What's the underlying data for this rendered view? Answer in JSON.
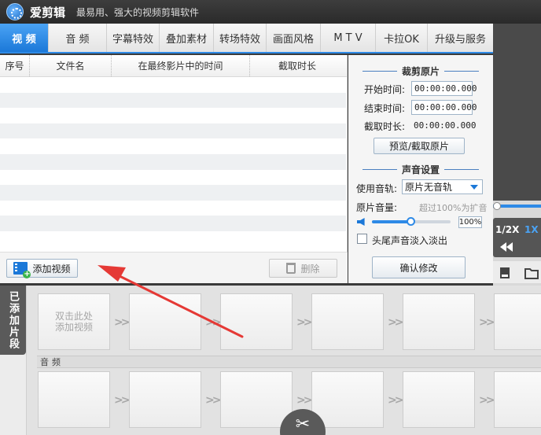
{
  "app": {
    "name": "爱剪辑",
    "slogan": "最易用、强大的视频剪辑软件"
  },
  "tabs": [
    {
      "label": "视 频",
      "active": true
    },
    {
      "label": "音 频",
      "active": false
    },
    {
      "label": "字幕特效",
      "active": false
    },
    {
      "label": "叠加素材",
      "active": false
    },
    {
      "label": "转场特效",
      "active": false
    },
    {
      "label": "画面风格",
      "active": false
    },
    {
      "label": "M T V",
      "active": false
    },
    {
      "label": "卡拉OK",
      "active": false
    },
    {
      "label": "升级与服务",
      "active": false
    }
  ],
  "file_table": {
    "columns": [
      "序号",
      "文件名",
      "在最终影片中的时间",
      "截取时长"
    ],
    "rows": []
  },
  "buttons": {
    "add_video": "添加视频",
    "delete": "删除",
    "preview_clip": "预览/截取原片",
    "confirm": "确认修改"
  },
  "clip_settings": {
    "title": "裁剪原片",
    "start_label": "开始时间:",
    "start_value": "00:00:00.000",
    "end_label": "结束时间:",
    "end_value": "00:00:00.000",
    "duration_label": "截取时长:",
    "duration_value": "00:00:00.000"
  },
  "sound_settings": {
    "title": "声音设置",
    "track_label": "使用音轨:",
    "track_value": "原片无音轨",
    "volume_label": "原片音量:",
    "volume_hint": "超过100%为扩音",
    "volume_percent": "100%",
    "volume_level": 0.5,
    "fade_label": "头尾声音淡入淡出",
    "fade_checked": false
  },
  "player": {
    "speed_half": "1/2X",
    "speed_1x": "1X"
  },
  "timeline": {
    "side_label": "已添加片段",
    "placeholder": "双击此处\n添加视频",
    "audio_label": "音频"
  },
  "colors": {
    "accent": "#2e8ae6",
    "arrow": "#e53935"
  }
}
